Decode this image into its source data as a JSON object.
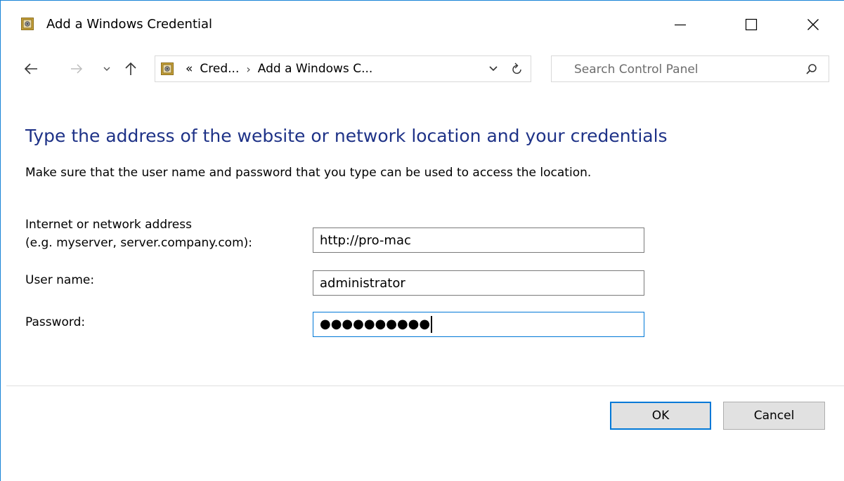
{
  "window": {
    "title": "Add a Windows Credential",
    "icon": "credential-manager-icon"
  },
  "navigation": {
    "back_icon": "arrow-left-icon",
    "forward_icon": "arrow-right-icon",
    "recent_icon": "chevron-down-icon",
    "up_icon": "arrow-up-icon",
    "breadcrumb_overflow": "«",
    "breadcrumbs": [
      "Cred...",
      "Add a Windows C..."
    ],
    "breadcrumb_separator": "›"
  },
  "search": {
    "placeholder": "Search Control Panel"
  },
  "content": {
    "heading": "Type the address of the website or network location and your credentials",
    "description": "Make sure that the user name and password that you type can be used to access the location.",
    "fields": {
      "address_label_line1": "Internet or network address",
      "address_label_line2": "(e.g. myserver, server.company.com):",
      "address_value": "http://pro-mac",
      "username_label": "User name:",
      "username_value": "administrator",
      "password_label": "Password:",
      "password_masked": "●●●●●●●●●●"
    }
  },
  "buttons": {
    "ok": "OK",
    "cancel": "Cancel"
  },
  "colors": {
    "heading": "#1e3287",
    "accent": "#0078d7",
    "window_border": "#1883d7"
  }
}
